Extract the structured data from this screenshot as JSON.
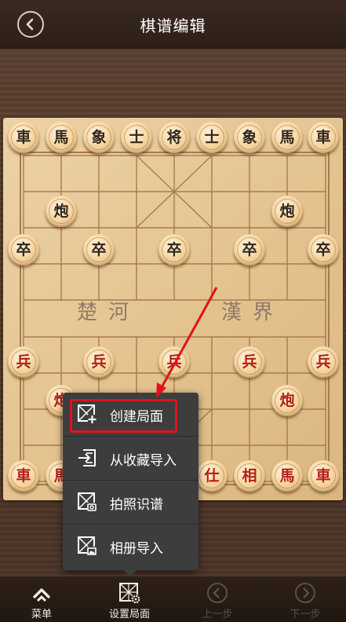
{
  "header": {
    "title": "棋谱编辑",
    "back_icon": "back-chevron-icon"
  },
  "board": {
    "river_left": "楚河",
    "river_right": "漢界"
  },
  "pieces": {
    "black_back_row": [
      "車",
      "馬",
      "象",
      "士",
      "将",
      "士",
      "象",
      "馬",
      "車"
    ],
    "black_cannons": [
      "炮",
      "炮"
    ],
    "black_soldiers": [
      "卒",
      "卒",
      "卒",
      "卒",
      "卒"
    ],
    "red_soldiers": [
      "兵",
      "兵",
      "兵",
      "兵",
      "兵"
    ],
    "red_cannons": [
      "炮",
      "炮"
    ],
    "red_back_row": [
      "車",
      "馬",
      "仕",
      "相",
      "馬",
      "車"
    ]
  },
  "popup_menu": {
    "items": [
      {
        "label": "创建局面",
        "icon": "create-position-icon"
      },
      {
        "label": "从收藏导入",
        "icon": "import-favorites-icon"
      },
      {
        "label": "拍照识谱",
        "icon": "photo-recognize-icon"
      },
      {
        "label": "相册导入",
        "icon": "album-import-icon"
      }
    ]
  },
  "bottom_bar": {
    "tabs": [
      {
        "label": "菜单",
        "icon": "menu-icon",
        "enabled": true
      },
      {
        "label": "设置局面",
        "icon": "setup-position-icon",
        "enabled": true
      },
      {
        "label": "上一步",
        "icon": "previous-step-icon",
        "enabled": false
      },
      {
        "label": "下一步",
        "icon": "next-step-icon",
        "enabled": false
      }
    ]
  },
  "colors": {
    "header_bg": "#2c1f17",
    "board": "#e2c18d",
    "red_piece_text": "#b32016",
    "black_piece_text": "#33261d",
    "highlight": "#e0131b",
    "popup_bg": "#3d3d3d"
  }
}
